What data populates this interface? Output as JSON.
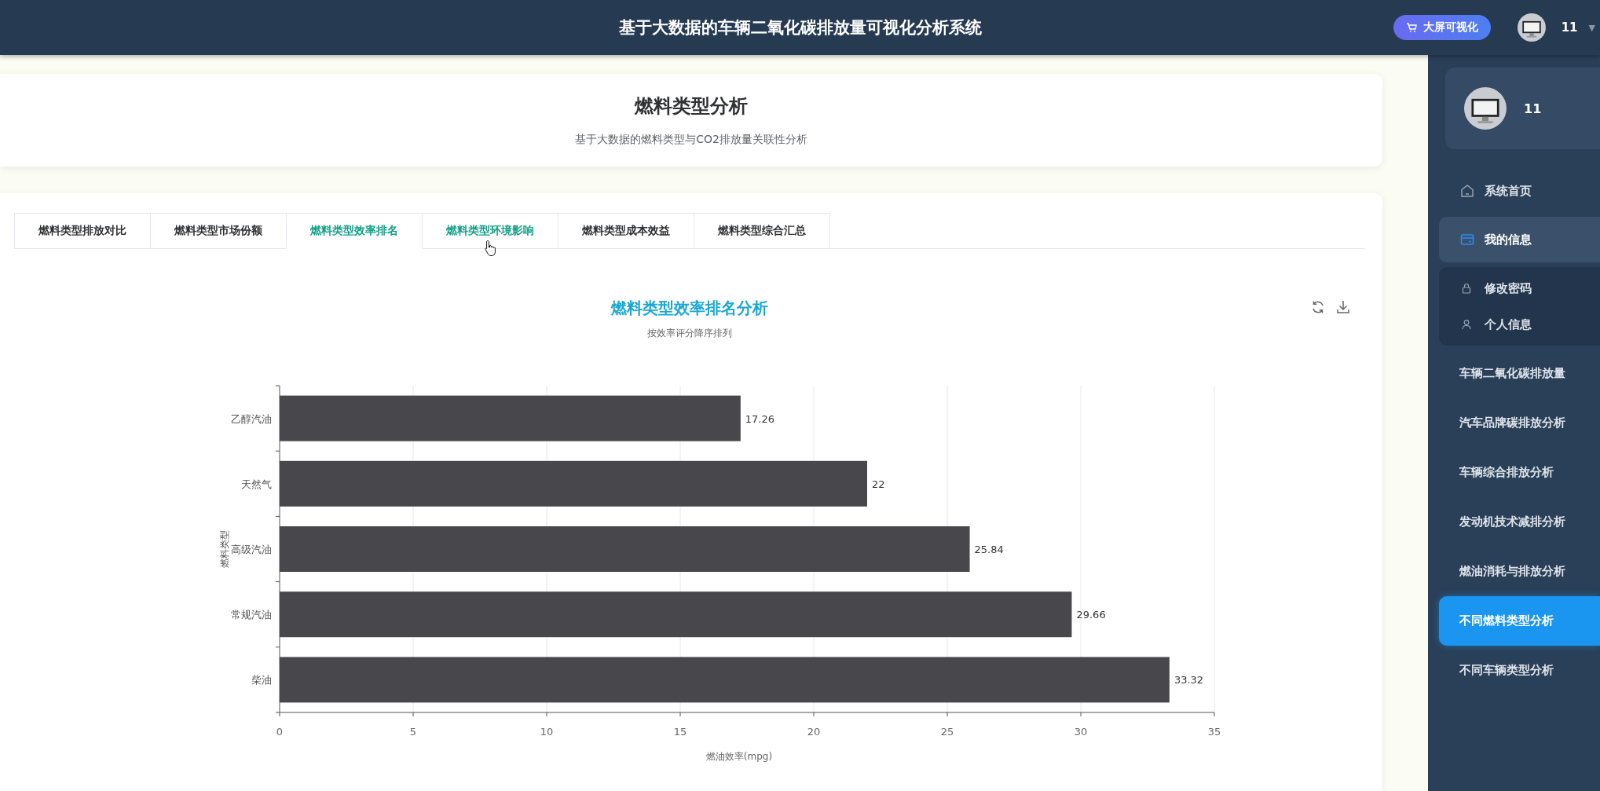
{
  "header": {
    "title": "基于大数据的车辆二氧化碳排放量可视化分析系统",
    "big_screen_button": "大屏可视化",
    "username": "11",
    "caret": "▼"
  },
  "page_card": {
    "title": "燃料类型分析",
    "subtitle": "基于大数据的燃料类型与CO2排放量关联性分析"
  },
  "tabs": [
    {
      "label": "燃料类型排放对比",
      "selected": false,
      "hovered": false
    },
    {
      "label": "燃料类型市场份额",
      "selected": false,
      "hovered": false
    },
    {
      "label": "燃料类型效率排名",
      "selected": true,
      "hovered": false
    },
    {
      "label": "燃料类型环境影响",
      "selected": false,
      "hovered": true
    },
    {
      "label": "燃料类型成本效益",
      "selected": false,
      "hovered": false
    },
    {
      "label": "燃料类型综合汇总",
      "selected": false,
      "hovered": false
    }
  ],
  "chart": {
    "title": "燃料类型效率排名分析",
    "subtitle": "按效率评分降序排列",
    "chart_data": {
      "type": "bar",
      "orientation": "horizontal",
      "xlabel": "燃油效率(mpg)",
      "ylabel": "燃料类型",
      "categories": [
        "乙醇汽油",
        "天然气",
        "高级汽油",
        "常规汽油",
        "柴油"
      ],
      "series": [
        {
          "color": "#48474b",
          "values": [
            17.26,
            22,
            25.84,
            29.66,
            33.32
          ]
        }
      ],
      "value_labels": [
        "17.26",
        "22",
        "25.84",
        "29.66",
        "33.32"
      ],
      "xlim": [
        0,
        35
      ],
      "xticks": [
        0,
        5,
        10,
        15,
        20,
        25,
        30,
        35
      ],
      "data_labels": true,
      "grid": true
    }
  },
  "sidebar": {
    "username": "11",
    "menu": [
      {
        "kind": "home",
        "label": "系统首页",
        "selected": false
      },
      {
        "kind": "card",
        "label": "我的信息",
        "selected": false,
        "expanded": true,
        "children": [
          {
            "kind": "lock",
            "label": "修改密码",
            "selected": false
          },
          {
            "kind": "user",
            "label": "个人信息",
            "selected": false
          }
        ]
      },
      {
        "kind": "plain",
        "label": "车辆二氧化碳排放量",
        "selected": false
      },
      {
        "kind": "plain",
        "label": "汽车品牌碳排放分析",
        "selected": false
      },
      {
        "kind": "plain",
        "label": "车辆综合排放分析",
        "selected": false
      },
      {
        "kind": "plain",
        "label": "发动机技术减排分析",
        "selected": false
      },
      {
        "kind": "plain",
        "label": "燃油消耗与排放分析",
        "selected": false
      },
      {
        "kind": "plain",
        "label": "不同燃料类型分析",
        "selected": true
      },
      {
        "kind": "plain",
        "label": "不同车辆类型分析",
        "selected": false
      }
    ]
  }
}
